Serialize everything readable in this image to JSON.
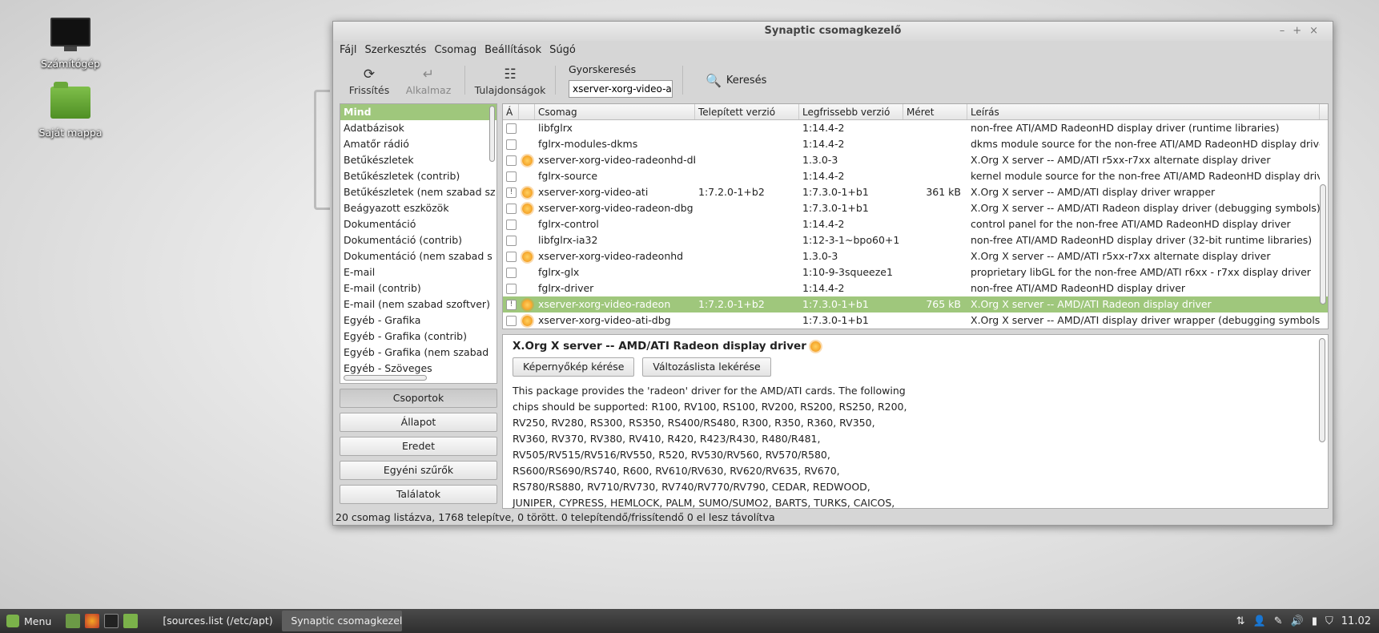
{
  "desktop": {
    "icons": [
      {
        "label": "Számítógép",
        "icon": "computer-icon"
      },
      {
        "label": "Saját mappa",
        "icon": "home-folder-icon"
      }
    ]
  },
  "window": {
    "title": "Synaptic csomagkezelő",
    "menu": [
      "Fájl",
      "Szerkesztés",
      "Csomag",
      "Beállítások",
      "Súgó"
    ],
    "toolbar": {
      "refresh": "Frissítés",
      "apply": "Alkalmaz",
      "properties": "Tulajdonságok",
      "quicksearch_label": "Gyorskeresés",
      "quicksearch_value": "xserver-xorg-video-ati",
      "search": "Keresés"
    },
    "categories": [
      "Mind",
      "Adatbázisok",
      "Amatőr rádió",
      "Betűkészletek",
      "Betűkészletek (contrib)",
      "Betűkészletek (nem szabad sz",
      "Beágyazott eszközök",
      "Dokumentáció",
      "Dokumentáció (contrib)",
      "Dokumentáció (nem szabad s",
      "E-mail",
      "E-mail (contrib)",
      "E-mail (nem szabad szoftver)",
      "Egyéb - Grafika",
      "Egyéb - Grafika (contrib)",
      "Egyéb - Grafika (nem szabad",
      "Egyéb - Szöveges"
    ],
    "side_buttons": [
      "Csoportok",
      "Állapot",
      "Eredet",
      "Egyéni szűrők",
      "Találatok"
    ],
    "columns": {
      "a": "Á",
      "pkg": "Csomag",
      "installed": "Telepített verzió",
      "latest": "Legfrissebb verzió",
      "size": "Méret",
      "desc": "Leírás"
    },
    "packages": [
      {
        "name": "libfglrx",
        "installed": "",
        "latest": "1:14.4-2",
        "size": "",
        "desc": "non-free ATI/AMD RadeonHD display driver (runtime libraries)",
        "support": false,
        "mark": false
      },
      {
        "name": "fglrx-modules-dkms",
        "installed": "",
        "latest": "1:14.4-2",
        "size": "",
        "desc": "dkms module source for the non-free ATI/AMD RadeonHD display driver",
        "support": false,
        "mark": false
      },
      {
        "name": "xserver-xorg-video-radeonhd-dbg",
        "installed": "",
        "latest": "1.3.0-3",
        "size": "",
        "desc": "X.Org X server -- AMD/ATI r5xx-r7xx alternate display driver",
        "support": true,
        "mark": false
      },
      {
        "name": "fglrx-source",
        "installed": "",
        "latest": "1:14.4-2",
        "size": "",
        "desc": "kernel module source for the non-free ATI/AMD RadeonHD display driver",
        "support": false,
        "mark": false
      },
      {
        "name": "xserver-xorg-video-ati",
        "installed": "1:7.2.0-1+b2",
        "latest": "1:7.3.0-1+b1",
        "size": "361 kB",
        "desc": "X.Org X server -- AMD/ATI display driver wrapper",
        "support": true,
        "mark": true
      },
      {
        "name": "xserver-xorg-video-radeon-dbg",
        "installed": "",
        "latest": "1:7.3.0-1+b1",
        "size": "",
        "desc": "X.Org X server -- AMD/ATI Radeon display driver (debugging symbols)",
        "support": true,
        "mark": false
      },
      {
        "name": "fglrx-control",
        "installed": "",
        "latest": "1:14.4-2",
        "size": "",
        "desc": "control panel for the non-free ATI/AMD RadeonHD display driver",
        "support": false,
        "mark": false
      },
      {
        "name": "libfglrx-ia32",
        "installed": "",
        "latest": "1:12-3-1~bpo60+1",
        "size": "",
        "desc": "non-free ATI/AMD RadeonHD display driver (32-bit runtime libraries)",
        "support": false,
        "mark": false
      },
      {
        "name": "xserver-xorg-video-radeonhd",
        "installed": "",
        "latest": "1.3.0-3",
        "size": "",
        "desc": "X.Org X server -- AMD/ATI r5xx-r7xx alternate display driver",
        "support": true,
        "mark": false
      },
      {
        "name": "fglrx-glx",
        "installed": "",
        "latest": "1:10-9-3squeeze1",
        "size": "",
        "desc": "proprietary libGL for the non-free AMD/ATI r6xx - r7xx display driver",
        "support": false,
        "mark": false
      },
      {
        "name": "fglrx-driver",
        "installed": "",
        "latest": "1:14.4-2",
        "size": "",
        "desc": "non-free ATI/AMD RadeonHD display driver",
        "support": false,
        "mark": false
      },
      {
        "name": "xserver-xorg-video-radeon",
        "installed": "1:7.2.0-1+b2",
        "latest": "1:7.3.0-1+b1",
        "size": "765 kB",
        "desc": "X.Org X server -- AMD/ATI Radeon display driver",
        "support": true,
        "mark": true,
        "selected": true
      },
      {
        "name": "xserver-xorg-video-ati-dbg",
        "installed": "",
        "latest": "1:7.3.0-1+b1",
        "size": "",
        "desc": "X.Org X server -- AMD/ATI display driver wrapper (debugging symbols)",
        "support": true,
        "mark": false
      }
    ],
    "details": {
      "title": "X.Org X server -- AMD/ATI Radeon display driver",
      "screenshot_btn": "Képernyőkép kérése",
      "changelog_btn": "Változáslista lekérése",
      "description": "This package provides the 'radeon' driver for the AMD/ATI cards. The following chips should be supported: R100, RV100, RS100, RV200, RS200, RS250, R200, RV250, RV280, RS300, RS350, RS400/RS480, R300, R350, R360, RV350, RV360, RV370, RV380, RV410, R420, R423/R430, R480/R481, RV505/RV515/RV516/RV550, R520, RV530/RV560, RV570/R580, RS600/RS690/RS740, R600, RV610/RV630, RV620/RV635, RV670, RS780/RS880, RV710/RV730, RV740/RV770/RV790, CEDAR, REDWOOD, JUNIPER, CYPRESS, HEMLOCK, PALM, SUMO/SUMO2, BARTS, TURKS, CAICOS, CAYMAN, ARUBA."
    },
    "status": "20 csomag listázva, 1768 telepítve, 0 törött. 0 telepítendő/frissítendő 0 el lesz távolítva"
  },
  "taskbar": {
    "menu_label": "Menu",
    "tasks": [
      "[sources.list (/etc/apt)...",
      "Synaptic csomagkezelő"
    ],
    "clock": "11.02"
  }
}
